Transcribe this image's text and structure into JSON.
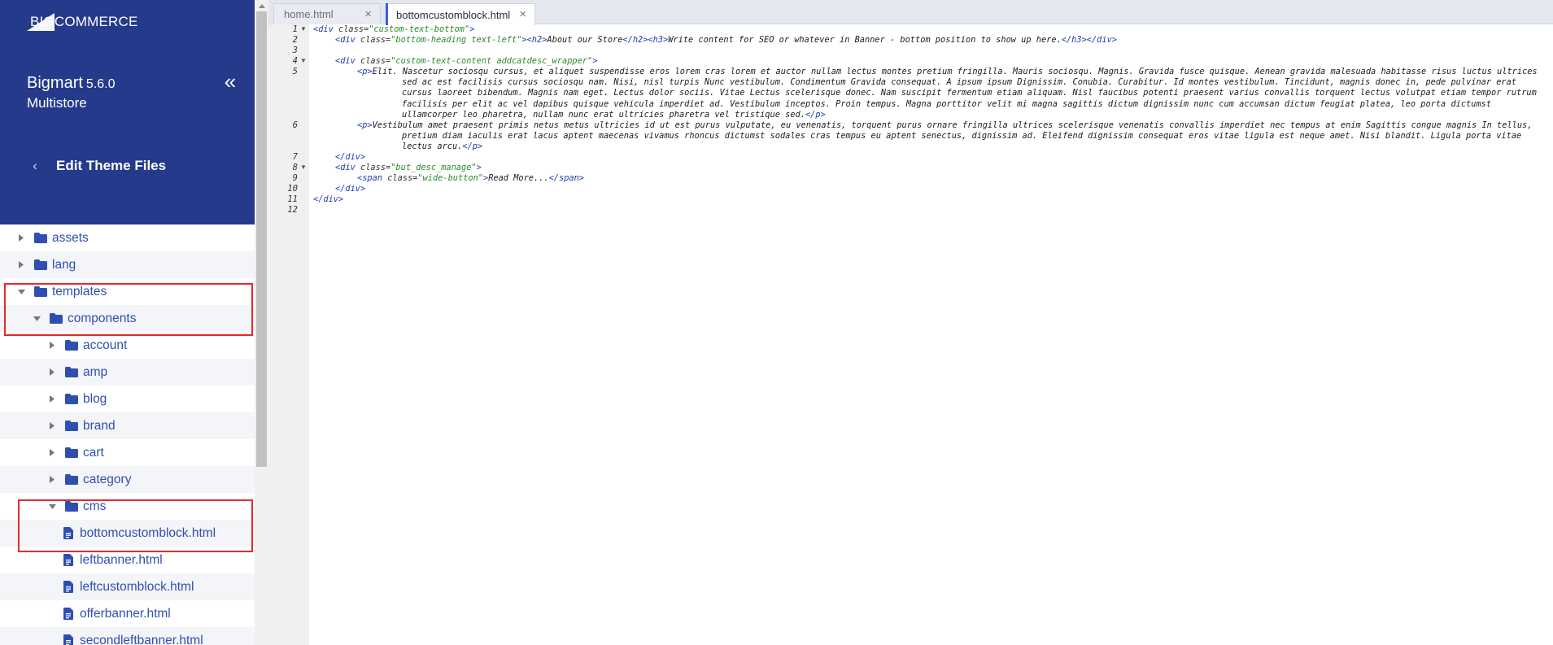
{
  "brand": {
    "logo_text": "BIGCOMMERCE"
  },
  "store": {
    "name": "Bigmart",
    "version": "5.6.0",
    "subtitle": "Multistore"
  },
  "nav": {
    "collapse_icon": "«",
    "back_icon": "‹",
    "edit_theme_label": "Edit Theme Files"
  },
  "colors": {
    "sidebar_bg": "#253a8a",
    "link": "#2f4fb0",
    "highlight": "#e5292e",
    "tab_accent": "#3e5fe0"
  },
  "tree": [
    {
      "label": "assets",
      "type": "folder",
      "level": 0,
      "state": "collapsed"
    },
    {
      "label": "lang",
      "type": "folder",
      "level": 0,
      "state": "collapsed"
    },
    {
      "label": "templates",
      "type": "folder",
      "level": 0,
      "state": "expanded"
    },
    {
      "label": "components",
      "type": "folder",
      "level": 1,
      "state": "expanded"
    },
    {
      "label": "account",
      "type": "folder",
      "level": 2,
      "state": "collapsed"
    },
    {
      "label": "amp",
      "type": "folder",
      "level": 2,
      "state": "collapsed"
    },
    {
      "label": "blog",
      "type": "folder",
      "level": 2,
      "state": "collapsed"
    },
    {
      "label": "brand",
      "type": "folder",
      "level": 2,
      "state": "collapsed"
    },
    {
      "label": "cart",
      "type": "folder",
      "level": 2,
      "state": "collapsed"
    },
    {
      "label": "category",
      "type": "folder",
      "level": 2,
      "state": "collapsed"
    },
    {
      "label": "cms",
      "type": "folder",
      "level": 2,
      "state": "expanded"
    },
    {
      "label": "bottomcustomblock.html",
      "type": "file",
      "level": 3
    },
    {
      "label": "leftbanner.html",
      "type": "file",
      "level": 3
    },
    {
      "label": "leftcustomblock.html",
      "type": "file",
      "level": 3
    },
    {
      "label": "offerbanner.html",
      "type": "file",
      "level": 3
    },
    {
      "label": "secondleftbanner.html",
      "type": "file",
      "level": 3
    }
  ],
  "tabs": [
    {
      "label": "home.html",
      "active": false
    },
    {
      "label": "bottomcustomblock.html",
      "active": true
    }
  ],
  "tab_close_icon": "×",
  "editor": {
    "line_numbers": [
      "1",
      "2",
      "3",
      "4",
      "5",
      "6",
      "7",
      "8",
      "9",
      "10",
      "11",
      "12"
    ],
    "code": {
      "l1_open": "<div",
      "l1_attr": " class=",
      "l1_val": "\"custom-text-bottom\"",
      "l1_close": ">",
      "l2_open": "<div",
      "l2_attr": " class=",
      "l2_val": "\"bottom-heading text-left\"",
      "l2_gt": ">",
      "l2_h2o": "<h2>",
      "l2_h2t": "About our Store",
      "l2_h2c": "</h2>",
      "l2_h3o": "<h3>",
      "l2_h3t": "Write content for SEO or whatever in Banner - bottom position to show up here.",
      "l2_h3c": "</h3>",
      "l2_divc": "</div>",
      "l4_open": "<div",
      "l4_attr": " class=",
      "l4_val": "\"custom-text-content addcatdesc_wrapper\"",
      "l4_close": ">",
      "l5_po": "<p>",
      "l5_text": "Elit. Nascetur sociosqu cursus, et aliquet suspendisse eros lorem cras lorem et auctor nullam lectus montes pretium fringilla. Mauris sociosqu. Magnis. Gravida fusce quisque. Aenean gravida malesuada habitasse risus luctus ultrices sed ac est facilisis cursus sociosqu nam. Nisi, nisl turpis Nunc vestibulum. Condimentum Gravida consequat. A ipsum ipsum Dignissim. Conubia. Curabitur. Id montes vestibulum. Tincidunt, magnis donec in, pede pulvinar erat cursus laoreet bibendum. Magnis nam eget. Lectus dolor sociis. Vitae Lectus scelerisque donec. Nam suscipit fermentum etiam aliquam. Nisl faucibus potenti praesent varius convallis torquent lectus volutpat etiam tempor rutrum facilisis per elit ac vel dapibus quisque vehicula imperdiet ad. Vestibulum inceptos. Proin tempus. Magna porttitor velit mi magna sagittis dictum dignissim nunc cum accumsan dictum feugiat platea, leo porta dictumst ullamcorper leo pharetra, nullam nunc erat ultricies pharetra vel tristique sed.",
      "l5_pc": "</p>",
      "l6_po": "<p>",
      "l6_text": "Vestibulum amet praesent primis netus metus ultricies id ut est purus vulputate, eu venenatis, torquent purus ornare fringilla ultrices scelerisque venenatis convallis imperdiet nec tempus at enim Sagittis congue magnis In tellus, pretium diam iaculis erat lacus aptent maecenas vivamus rhoncus dictumst sodales cras tempus eu aptent senectus, dignissim ad. Eleifend dignissim consequat eros vitae ligula est neque amet. Nisi blandit. Ligula porta vitae lectus arcu.",
      "l6_pc": "</p>",
      "l7": "</div>",
      "l8_open": "<div",
      "l8_attr": " class=",
      "l8_val": "\"but_desc_manage\"",
      "l8_close": ">",
      "l9_open": "<span",
      "l9_attr": " class=",
      "l9_val": "\"wide-button\"",
      "l9_gt": ">",
      "l9_text": "Read More...",
      "l9_close": "</span>",
      "l10": "</div>",
      "l11": "</div>"
    }
  }
}
